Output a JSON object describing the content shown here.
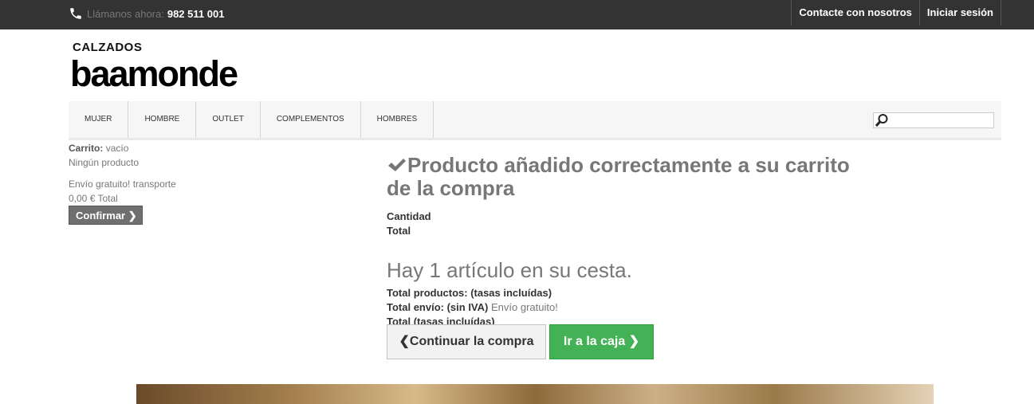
{
  "topbar": {
    "call_label": "Llámanos ahora:",
    "phone": "982 511 001",
    "links": [
      "Contacte con nosotros",
      "Iniciar sesión"
    ]
  },
  "logo": {
    "line1": "CALZADOS",
    "line2": "baamonde"
  },
  "nav": {
    "items": [
      "MUJER",
      "HOMBRE",
      "OUTLET",
      "COMPLEMENTOS",
      "HOMBRES"
    ]
  },
  "search": {
    "placeholder": ""
  },
  "cart": {
    "label": "Carrito:",
    "status": "vacío",
    "no_product": "Ningún producto",
    "shipping": "Envío gratuito! transporte",
    "total": "0,00 € Total",
    "confirm_label": "Confirmar"
  },
  "layer": {
    "success": "Producto añadido correctamente a su carrito de la compra",
    "quantity_label": "Cantidad",
    "total_label": "Total",
    "count_msg": "Hay 1 artículo en su cesta.",
    "products_label": "Total productos: (tasas incluídas)",
    "shipping_label": "Total envío: (sin IVA)",
    "shipping_value": "Envío gratuito!",
    "grand_total_label": "Total (tasas incluídas)",
    "continue_label": "Continuar la compra",
    "checkout_label": "Ir a la caja"
  },
  "colors": {
    "topbar": "#333333",
    "checkout": "#43b155",
    "confirm": "#6f6f6f"
  },
  "icons": [
    "phone-icon",
    "search-icon",
    "check-icon",
    "chevron-left-icon",
    "chevron-right-icon"
  ]
}
